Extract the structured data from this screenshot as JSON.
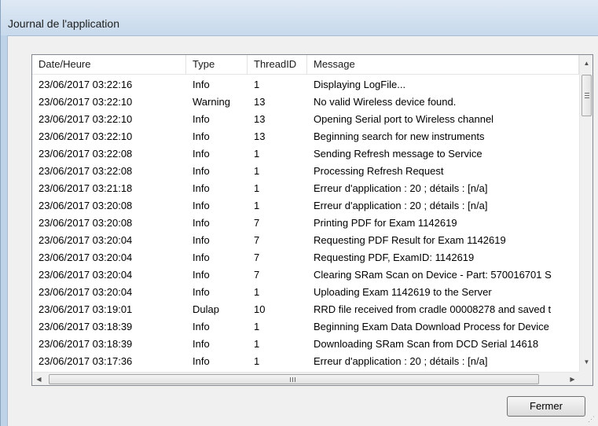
{
  "window": {
    "title": "Journal de l'application"
  },
  "log": {
    "columns": {
      "date": "Date/Heure",
      "type": "Type",
      "thread": "ThreadID",
      "message": "Message"
    },
    "rows": [
      {
        "date": "23/06/2017 03:22:16",
        "type": "Info",
        "thread": "1",
        "message": "Displaying LogFile..."
      },
      {
        "date": "23/06/2017 03:22:10",
        "type": "Warning",
        "thread": "13",
        "message": "No valid Wireless device found."
      },
      {
        "date": "23/06/2017 03:22:10",
        "type": "Info",
        "thread": "13",
        "message": "Opening Serial port to Wireless channel"
      },
      {
        "date": "23/06/2017 03:22:10",
        "type": "Info",
        "thread": "13",
        "message": "Beginning search for new instruments"
      },
      {
        "date": "23/06/2017 03:22:08",
        "type": "Info",
        "thread": "1",
        "message": "Sending Refresh message to Service"
      },
      {
        "date": "23/06/2017 03:22:08",
        "type": "Info",
        "thread": "1",
        "message": "Processing Refresh Request"
      },
      {
        "date": "23/06/2017 03:21:18",
        "type": "Info",
        "thread": "1",
        "message": "Erreur d'application : 20 ; détails : [n/a]"
      },
      {
        "date": "23/06/2017 03:20:08",
        "type": "Info",
        "thread": "1",
        "message": "Erreur d'application : 20 ; détails : [n/a]"
      },
      {
        "date": "23/06/2017 03:20:08",
        "type": "Info",
        "thread": "7",
        "message": "Printing PDF for Exam 1142619"
      },
      {
        "date": "23/06/2017 03:20:04",
        "type": "Info",
        "thread": "7",
        "message": "Requesting PDF Result for Exam 1142619"
      },
      {
        "date": "23/06/2017 03:20:04",
        "type": "Info",
        "thread": "7",
        "message": "Requesting PDF, ExamID: 1142619"
      },
      {
        "date": "23/06/2017 03:20:04",
        "type": "Info",
        "thread": "7",
        "message": "Clearing SRam Scan on Device - Part: 570016701 S"
      },
      {
        "date": "23/06/2017 03:20:04",
        "type": "Info",
        "thread": "1",
        "message": "Uploading Exam 1142619 to the Server"
      },
      {
        "date": "23/06/2017 03:19:01",
        "type": "Dulap",
        "thread": "10",
        "message": "RRD file received from cradle 00008278 and saved t"
      },
      {
        "date": "23/06/2017 03:18:39",
        "type": "Info",
        "thread": "1",
        "message": "Beginning Exam Data Download Process for Device"
      },
      {
        "date": "23/06/2017 03:18:39",
        "type": "Info",
        "thread": "1",
        "message": "Downloading SRam Scan from DCD Serial 14618"
      },
      {
        "date": "23/06/2017 03:17:36",
        "type": "Info",
        "thread": "1",
        "message": "Erreur d'application : 20 ; détails : [n/a]"
      }
    ]
  },
  "buttons": {
    "close_label": "Fermer"
  },
  "icons": {
    "scroll_up": "arrow-up-icon",
    "scroll_down": "arrow-down-icon",
    "scroll_left": "arrow-left-icon",
    "scroll_right": "arrow-right-icon"
  }
}
